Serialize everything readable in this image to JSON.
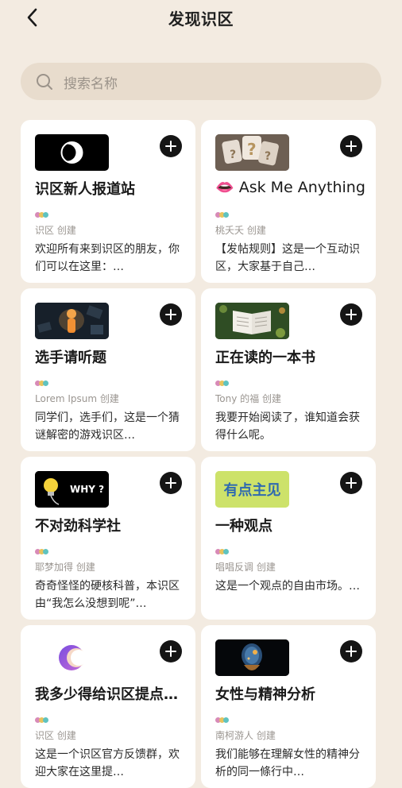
{
  "header": {
    "title": "发现识区",
    "back_icon": "chevron-left-icon"
  },
  "search": {
    "placeholder": "搜索名称",
    "icon": "search-icon"
  },
  "dot_colors": [
    "#d88ab7",
    "#e8c35d",
    "#5fc3c0"
  ],
  "cards": [
    {
      "title": "识区新人报道站",
      "creator": "识区 创建",
      "desc": "欢迎所有来到识区的朋友，你们可以在这里：…",
      "thumb": "eclipse-logo"
    },
    {
      "title": "👄 Ask Me Anything",
      "creator": "桃夭夭 创建",
      "desc": "【发帖规则】这是一个互动识区，大家基于自己…",
      "thumb": "question-marks"
    },
    {
      "title": "选手请听题",
      "creator": "Lorem Ipsum 创建",
      "desc": "同学们，选手们，这是一个猜谜解密的游戏识区…",
      "thumb": "puzzle-figure"
    },
    {
      "title": "正在读的一本书",
      "creator": "Tony 的福 创建",
      "desc": "我要开始阅读了，谁知道会获得什么呢。",
      "thumb": "open-book"
    },
    {
      "title": "不对劲科学社",
      "creator": "耶梦加得 创建",
      "desc": "奇奇怪怪的硬核科普，本识区由“我怎么没想到呢”…",
      "thumb": "why-bulb",
      "thumb_text": "WHY ?"
    },
    {
      "title": "一种观点",
      "creator": "唱唱反调 创建",
      "desc": "这是一个观点的自由市场。…",
      "thumb": "opinion-text",
      "thumb_text": "有点主见"
    },
    {
      "title": "我多少得给识区提点…",
      "creator": "识区 创建",
      "desc": "这是一个识区官方反馈群，欢迎大家在这里提…",
      "thumb": "moon-logo"
    },
    {
      "title": "女性与精神分析",
      "creator": "南柯游人 创建",
      "desc": "我们能够在理解女性的精神分析的同一條行中…",
      "thumb": "robot-head"
    }
  ]
}
